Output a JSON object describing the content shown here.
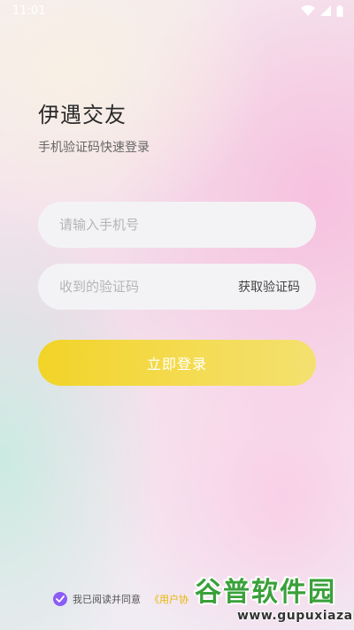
{
  "status_bar": {
    "time": "11:01",
    "icons": [
      "wifi-icon",
      "signal-icon",
      "battery-icon"
    ]
  },
  "header": {
    "title": "伊遇交友",
    "subtitle": "手机验证码快速登录"
  },
  "form": {
    "phone_placeholder": "请输入手机号",
    "phone_value": "",
    "code_placeholder": "收到的验证码",
    "code_value": "",
    "get_code_label": "获取验证码",
    "login_label": "立即登录"
  },
  "agreement": {
    "checked": true,
    "text": "我已阅读并同意",
    "link_text": "《用户协"
  },
  "watermark": {
    "main": "谷普软件园",
    "url": "www.gupuxiazai.com"
  },
  "colors": {
    "accent_yellow": "#f2d327",
    "check_purple": "#8b5cf6",
    "link_gold": "#e8b600"
  }
}
